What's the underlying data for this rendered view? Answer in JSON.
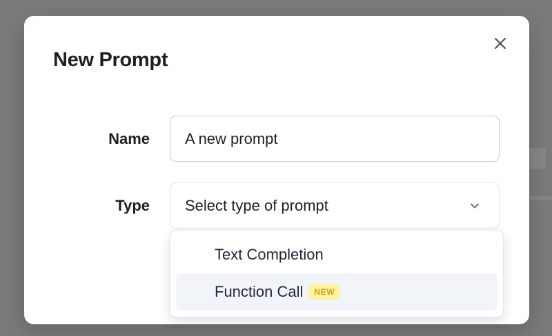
{
  "modal": {
    "title": "New Prompt"
  },
  "form": {
    "name_label": "Name",
    "name_value": "A new prompt",
    "type_label": "Type",
    "type_placeholder": "Select type of prompt"
  },
  "dropdown": {
    "options": [
      {
        "label": "Text Completion"
      },
      {
        "label": "Function Call",
        "badge": "NEW"
      }
    ]
  },
  "icons": {
    "close": "close-icon",
    "chevron": "chevron-down-icon"
  },
  "colors": {
    "badge_bg": "#fff1a8",
    "badge_text": "#d4a200",
    "highlight": "#f1f4f9"
  }
}
